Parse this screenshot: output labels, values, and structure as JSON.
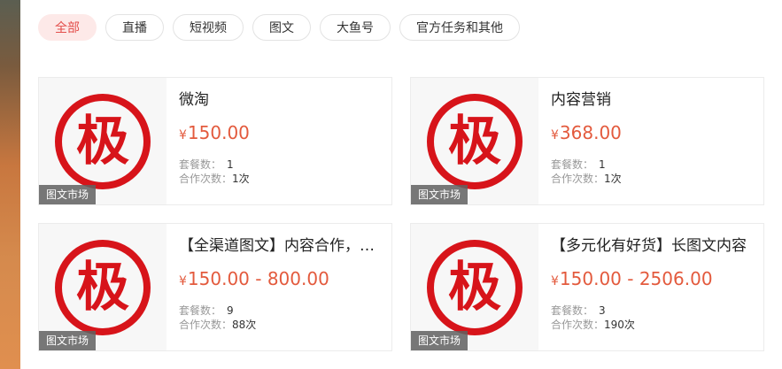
{
  "filters": [
    {
      "label": "全部",
      "active": true
    },
    {
      "label": "直播",
      "active": false
    },
    {
      "label": "短视频",
      "active": false
    },
    {
      "label": "图文",
      "active": false
    },
    {
      "label": "大鱼号",
      "active": false
    },
    {
      "label": "官方任务和其他",
      "active": false
    }
  ],
  "cards": [
    {
      "title": "微淘",
      "currency": "¥",
      "price": "150.00",
      "package_label": "套餐数：",
      "package_count": "1",
      "coop_label": "合作次数：",
      "coop_count": "1次",
      "tag": "图文市场",
      "logo_char": "极",
      "logo_icon": "ji-seal-icon",
      "logo_color": "#d7141a"
    },
    {
      "title": "内容营销",
      "currency": "¥",
      "price": "368.00",
      "package_label": "套餐数：",
      "package_count": "1",
      "coop_label": "合作次数：",
      "coop_count": "1次",
      "tag": "图文市场",
      "logo_char": "极",
      "logo_icon": "ji-seal-icon",
      "logo_color": "#d7141a"
    },
    {
      "title": "【全渠道图文】内容合作，专业达人团队",
      "currency": "¥",
      "price": "150.00 - 800.00",
      "package_label": "套餐数：",
      "package_count": "9",
      "coop_label": "合作次数：",
      "coop_count": "88次",
      "tag": "图文市场",
      "logo_char": "极",
      "logo_icon": "ji-seal-icon",
      "logo_color": "#d7141a"
    },
    {
      "title": "【多元化有好货】长图文内容",
      "currency": "¥",
      "price": "150.00 - 2506.00",
      "package_label": "套餐数：",
      "package_count": "3",
      "coop_label": "合作次数：",
      "coop_count": "190次",
      "tag": "图文市场",
      "logo_char": "极",
      "logo_icon": "ji-seal-icon",
      "logo_color": "#d7141a"
    }
  ],
  "colors": {
    "accent": "#e34d4a",
    "price": "#e35a3d"
  }
}
